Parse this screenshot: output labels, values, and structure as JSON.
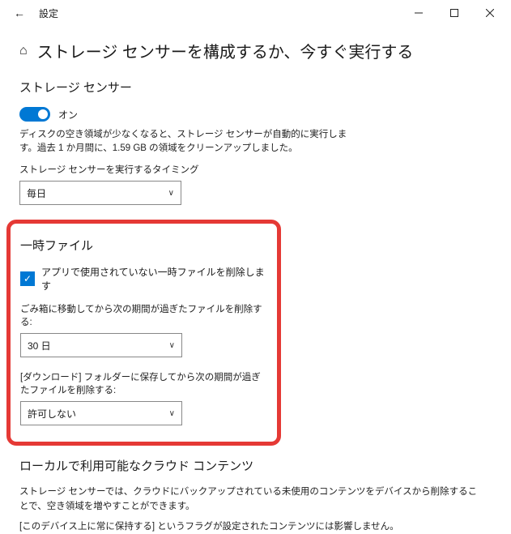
{
  "titlebar": {
    "title": "設定"
  },
  "page": {
    "title": "ストレージ センサーを構成するか、今すぐ実行する"
  },
  "storage_sense": {
    "heading": "ストレージ センサー",
    "toggle_label": "オン",
    "description": "ディスクの空き領域が少なくなると、ストレージ センサーが自動的に実行します。過去 1 か月間に、1.59 GB の領域をクリーンアップしました。",
    "timing_label": "ストレージ センサーを実行するタイミング",
    "timing_value": "毎日"
  },
  "temp_files": {
    "heading": "一時ファイル",
    "checkbox_label": "アプリで使用されていない一時ファイルを削除します",
    "recycle_label": "ごみ箱に移動してから次の期間が過ぎたファイルを削除する:",
    "recycle_value": "30 日",
    "downloads_label": "[ダウンロード] フォルダーに保存してから次の期間が過ぎたファイルを削除する:",
    "downloads_value": "許可しない"
  },
  "cloud": {
    "heading": "ローカルで利用可能なクラウド コンテンツ",
    "description": "ストレージ センサーでは、クラウドにバックアップされている未使用のコンテンツをデバイスから削除することで、空き領域を増やすことができます。",
    "keep_note": "[このデバイス上に常に保持する] というフラグが設定されたコンテンツには影響しません。"
  }
}
